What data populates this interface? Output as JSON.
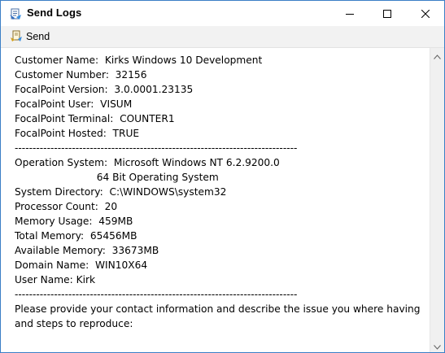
{
  "window": {
    "title": "Send Logs",
    "icon": "log-send-icon",
    "controls": [
      "minimize-icon",
      "maximize-icon",
      "close-icon"
    ]
  },
  "toolbar": {
    "send_label": "Send",
    "send_icon": "send-icon"
  },
  "log": {
    "lines": [
      "Customer Name:  Kirks Windows 10 Development",
      "Customer Number:  32156",
      "FocalPoint Version:  3.0.0001.23135",
      "FocalPoint User:  VISUM",
      "FocalPoint Terminal:  COUNTER1",
      "FocalPoint Hosted:  TRUE",
      "-------------------------------------------------------------------------------",
      "Operation System:  Microsoft Windows NT 6.2.9200.0",
      "                          64 Bit Operating System",
      "System Directory:  C:\\WINDOWS\\system32",
      "Processor Count:  20",
      "Memory Usage:  459MB",
      "Total Memory:  65456MB",
      "Available Memory:  33673MB",
      "Domain Name:  WIN10X64",
      "User Name: Kirk",
      "-------------------------------------------------------------------------------"
    ],
    "prompt": "Please provide your contact information and describe the issue you where having and steps to reproduce:"
  },
  "colors": {
    "window_border": "#3b7fc6",
    "toolbar_bg": "#f2f2f2"
  }
}
